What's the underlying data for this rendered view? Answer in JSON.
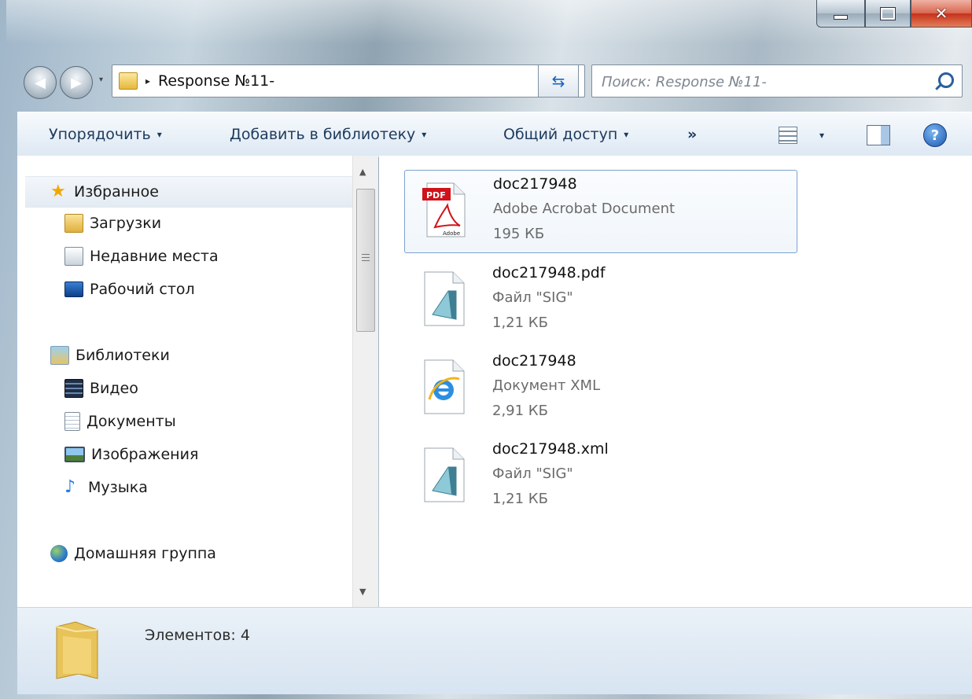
{
  "window": {
    "controls": {
      "minimize": "minimize-icon",
      "maximize": "maximize-icon",
      "close": "close-icon"
    }
  },
  "address_bar": {
    "current_folder": "Response №11-",
    "path_separator": "▸",
    "dropdown": "▾"
  },
  "search": {
    "placeholder": "Поиск: Response №11-"
  },
  "toolbar": {
    "organize": "Упорядочить",
    "add_to_library": "Добавить в библиотеку",
    "share": "Общий доступ",
    "more": "»",
    "caret": "▾",
    "help": "?"
  },
  "nav_pane": {
    "favorites": [
      {
        "label": "Избранное",
        "icon": "star-icon"
      },
      {
        "label": "Загрузки",
        "icon": "downloads-folder-icon"
      },
      {
        "label": "Недавние места",
        "icon": "recent-places-icon"
      },
      {
        "label": "Рабочий стол",
        "icon": "desktop-icon"
      }
    ],
    "libraries": [
      {
        "label": "Библиотеки",
        "icon": "libraries-icon"
      },
      {
        "label": "Видео",
        "icon": "video-icon"
      },
      {
        "label": "Документы",
        "icon": "documents-icon"
      },
      {
        "label": "Изображения",
        "icon": "pictures-icon"
      },
      {
        "label": "Музыка",
        "icon": "music-icon"
      }
    ],
    "homegroup": {
      "label": "Домашняя группа",
      "icon": "homegroup-icon"
    }
  },
  "files": [
    {
      "name": "doc217948",
      "type": "Adobe Acrobat Document",
      "size": "195 КБ",
      "icon": "pdf-icon",
      "selected": true
    },
    {
      "name": "doc217948.pdf",
      "type": "Файл \"SIG\"",
      "size": "1,21 КБ",
      "icon": "generic-file-icon",
      "selected": false
    },
    {
      "name": "doc217948",
      "type": "Документ XML",
      "size": "2,91 КБ",
      "icon": "ie-xml-icon",
      "selected": false
    },
    {
      "name": "doc217948.xml",
      "type": "Файл \"SIG\"",
      "size": "1,21 КБ",
      "icon": "generic-file-icon",
      "selected": false
    }
  ],
  "status_bar": {
    "text": "Элементов: 4"
  },
  "colors": {
    "accent": "#1d3a5c",
    "selection_border": "#7da2ce",
    "close_button": "#c4311c"
  }
}
